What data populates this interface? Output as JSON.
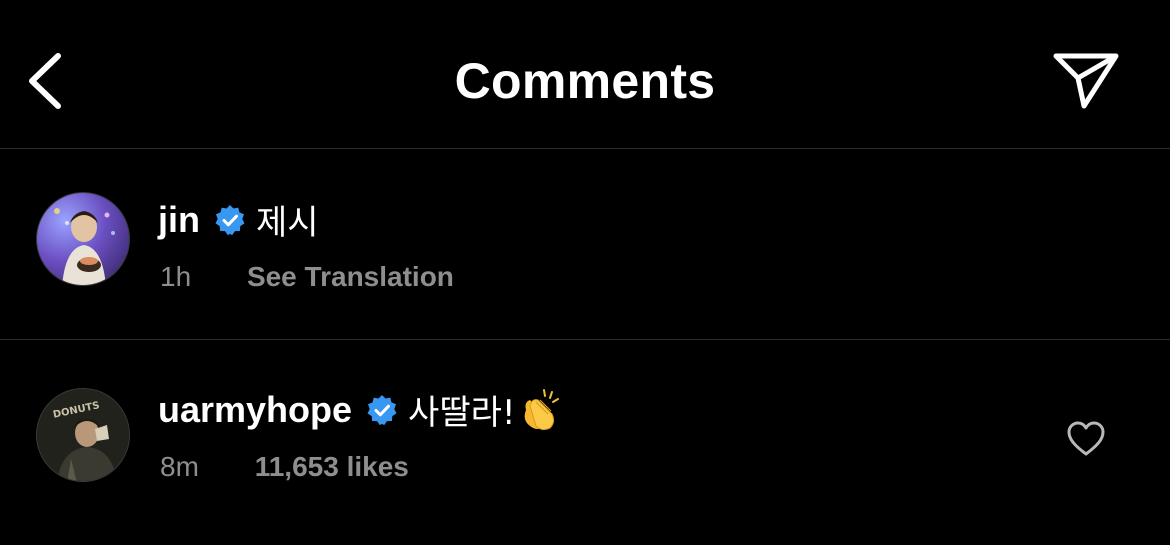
{
  "header": {
    "back_icon": "chevron-left-icon",
    "title": "Comments",
    "share_icon": "paper-plane-icon"
  },
  "comments": [
    {
      "username": "jin",
      "verified": true,
      "text": "제시",
      "time": "1h",
      "action": "See Translation"
    },
    {
      "username": "uarmyhope",
      "verified": true,
      "text": "사딸라!",
      "emoji": "clapping-hands-icon",
      "time": "8m",
      "likes": "11,653 likes",
      "like_icon": "heart-outline-icon"
    }
  ],
  "colors": {
    "background": "#000000",
    "text": "#ffffff",
    "muted": "#8e8e8e",
    "verified": "#3897f0",
    "divider": "#2a2a2a"
  }
}
